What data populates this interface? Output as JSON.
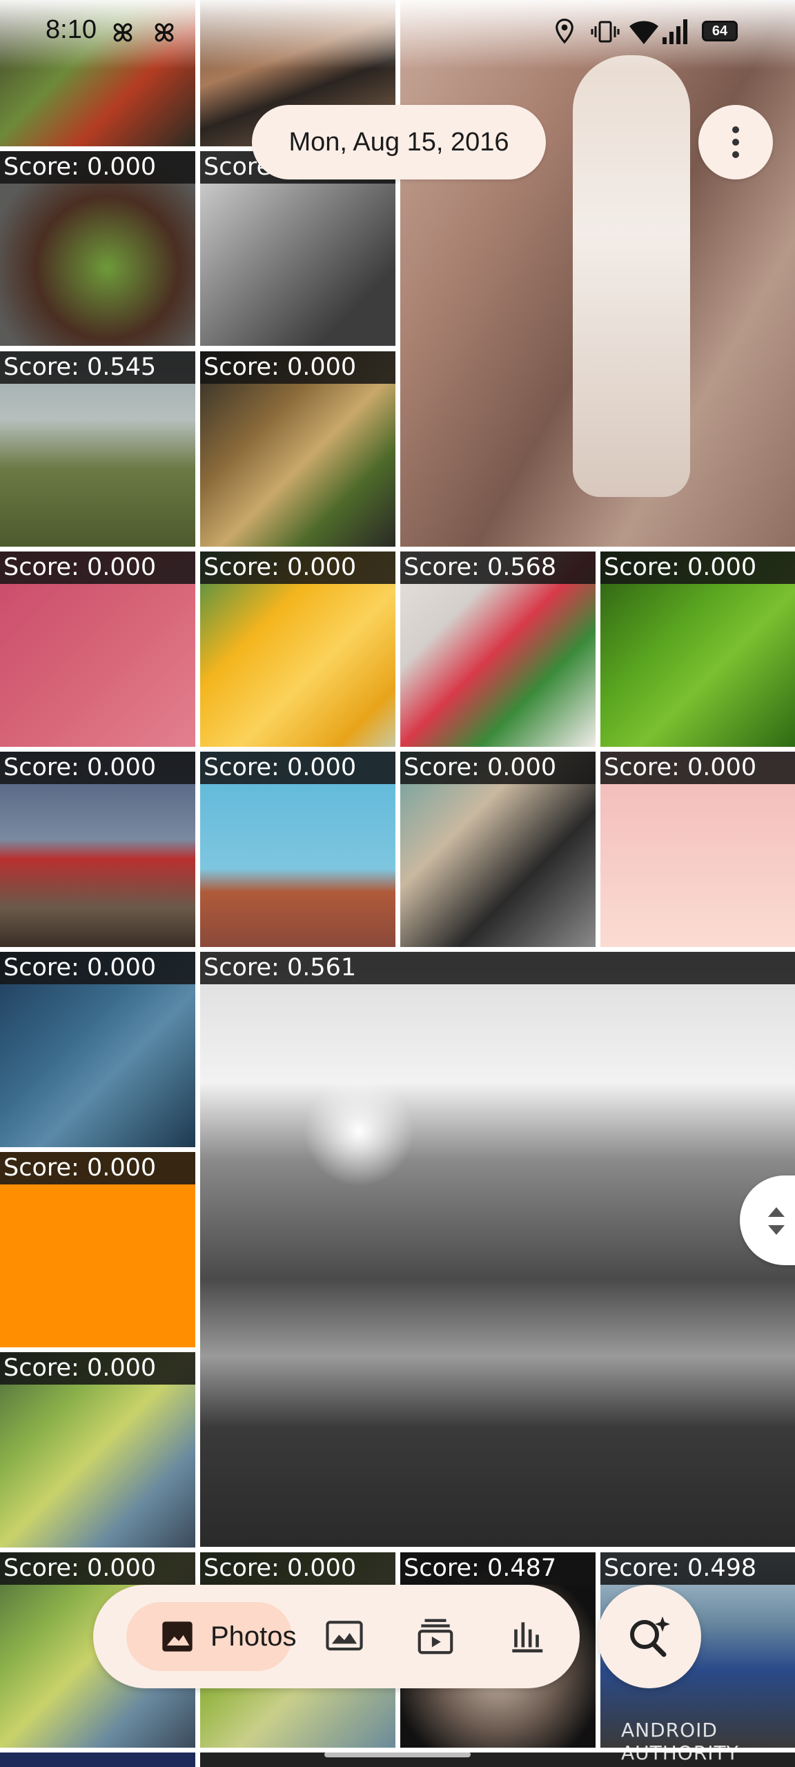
{
  "status_bar": {
    "time": "8:10",
    "battery": "64",
    "icons": [
      "pinwheel-icon",
      "pinwheel-icon",
      "location-icon",
      "vibrate-icon",
      "wifi-icon",
      "signal-icon",
      "battery-icon"
    ]
  },
  "header": {
    "date": "Mon, Aug 15, 2016",
    "menu_icon": "more-vert-icon"
  },
  "grid": {
    "tiles": [
      {
        "score": ""
      },
      {
        "score": ""
      },
      {
        "score": ""
      },
      {
        "score": "Score: 0.000"
      },
      {
        "score": "Score: 0.000"
      },
      {
        "score": "Score: 0.545"
      },
      {
        "score": "Score: 0.000"
      },
      {
        "score": "Score: 0.000"
      },
      {
        "score": "Score: 0.000"
      },
      {
        "score": "Score: 0.568"
      },
      {
        "score": "Score: 0.000"
      },
      {
        "score": "Score: 0.000"
      },
      {
        "score": "Score: 0.000"
      },
      {
        "score": "Score: 0.000"
      },
      {
        "score": "Score: 0.000"
      },
      {
        "score": "Score: 0.000"
      },
      {
        "score": "Score: 0.561"
      },
      {
        "score": "Score: 0.000"
      },
      {
        "score": "Score: 0.000"
      },
      {
        "score": "Score: 0.000"
      },
      {
        "score": "Score: 0.000"
      },
      {
        "score": "Score: 0.487"
      },
      {
        "score": "Score: 0.498"
      }
    ]
  },
  "bottom_nav": {
    "photos_label": "Photos",
    "items": [
      "photos-icon",
      "collections-icon",
      "memories-icon",
      "library-icon"
    ],
    "search_icon": "search-sparkle-icon"
  },
  "watermark": "ANDROID AUTHORITY",
  "colors": {
    "chip_bg": "#fbeee7",
    "active_pill": "#fcd9c8",
    "score_bg": "#141414"
  }
}
